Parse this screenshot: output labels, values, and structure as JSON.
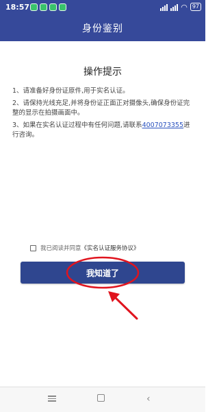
{
  "status_bar": {
    "time": "18:57",
    "signal_text": "..ıl",
    "battery": "97"
  },
  "header": {
    "title": "身份鉴别"
  },
  "main": {
    "heading": "操作提示",
    "tip1": "1、请准备好身份证原件,用于实名认证。",
    "tip2": "2、请保持光线充足,并将身份证正面正对摄像头,确保身份证完整的显示在拍摄画面中。",
    "tip3_prefix": "3、如果在实名认证过程中有任何问题,请联系",
    "tip3_phone": "4007073355",
    "tip3_suffix": "进行咨询。"
  },
  "agreement": {
    "prefix": "我已阅读并同意",
    "link": "《实名认证服务协议》"
  },
  "actions": {
    "confirm_label": "我知道了"
  },
  "colors": {
    "brand": "#36499a",
    "button": "#2f468f",
    "annotation": "#e0141e"
  },
  "icons": {
    "menu": "menu-icon",
    "home": "home-icon",
    "back": "back-icon"
  }
}
